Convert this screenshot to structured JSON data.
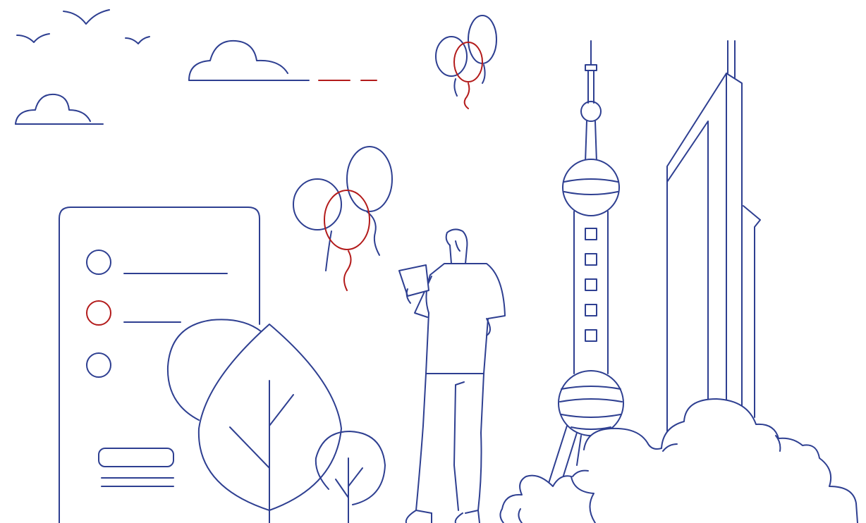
{
  "illustration": {
    "style": "line-art",
    "colors": {
      "primary": "#2e3f91",
      "accent": "#b31b1b",
      "background": "#ffffff"
    },
    "icons": [
      "bird-icon",
      "cloud-icon",
      "balloon-icon",
      "document-card-icon",
      "radio-option-icon",
      "tree-icon",
      "leaf-icon",
      "person-icon",
      "tv-tower-icon",
      "skyscraper-icon",
      "bush-icon"
    ],
    "form_card": {
      "options": [
        {
          "selected": false
        },
        {
          "selected": true
        },
        {
          "selected": false
        }
      ]
    }
  }
}
